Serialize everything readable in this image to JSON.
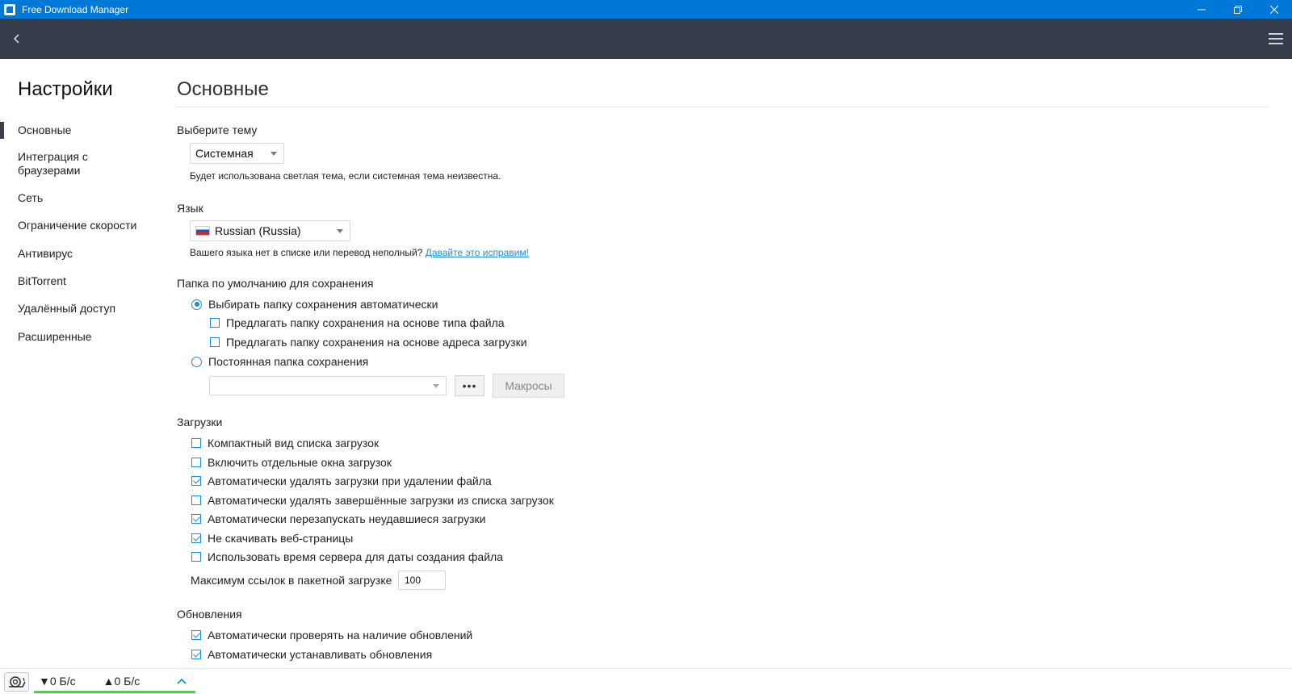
{
  "window": {
    "title": "Free Download Manager"
  },
  "sidebar": {
    "title": "Настройки",
    "items": [
      {
        "label": "Основные",
        "active": true
      },
      {
        "label": "Интеграция с браузерами"
      },
      {
        "label": "Сеть"
      },
      {
        "label": "Ограничение скорости"
      },
      {
        "label": "Антивирус"
      },
      {
        "label": "BitTorrent"
      },
      {
        "label": "Удалённый доступ"
      },
      {
        "label": "Расширенные"
      }
    ]
  },
  "main": {
    "title": "Основные",
    "theme": {
      "label": "Выберите тему",
      "value": "Системная",
      "hint": "Будет использована светлая тема, если системная тема неизвестна."
    },
    "language": {
      "label": "Язык",
      "value": "Russian (Russia)",
      "hint": "Вашего языка нет в списке или перевод неполный?",
      "link": "Давайте это исправим!"
    },
    "save_folder": {
      "label": "Папка по умолчанию для сохранения",
      "auto_option": "Выбирать папку сохранения автоматически",
      "by_type_option": "Предлагать папку сохранения на основе типа файла",
      "by_url_option": "Предлагать папку сохранения на основе адреса загрузки",
      "fixed_option": "Постоянная папка сохранения",
      "browse_label": "•••",
      "macros_label": "Макросы",
      "auto_selected": true
    },
    "downloads": {
      "label": "Загрузки",
      "options": [
        {
          "label": "Компактный вид списка загрузок",
          "checked": false
        },
        {
          "label": "Включить отдельные окна загрузок",
          "checked": false
        },
        {
          "label": "Автоматически удалять загрузки при удалении файла",
          "checked": true
        },
        {
          "label": "Автоматически удалять завершённые загрузки из списка загрузок",
          "checked": false
        },
        {
          "label": "Автоматически перезапускать неудавшиеся загрузки",
          "checked": true
        },
        {
          "label": "Не скачивать веб-страницы",
          "checked": true
        },
        {
          "label": "Использовать время сервера для даты создания файла",
          "checked": false
        }
      ],
      "max_links_label": "Максимум ссылок в пакетной загрузке",
      "max_links_value": "100"
    },
    "updates": {
      "label": "Обновления",
      "options": [
        {
          "label": "Автоматически проверять на наличие обновлений",
          "checked": true
        },
        {
          "label": "Автоматически устанавливать обновления",
          "checked": true
        }
      ]
    }
  },
  "statusbar": {
    "down_speed": "▼0 Б/с",
    "up_speed": "▲0 Б/с"
  },
  "colors": {
    "titlebar": "#0078d7",
    "toolbar": "#363e4c",
    "accent": "#1a8fd8",
    "speed_bar": "#5fc45b"
  }
}
